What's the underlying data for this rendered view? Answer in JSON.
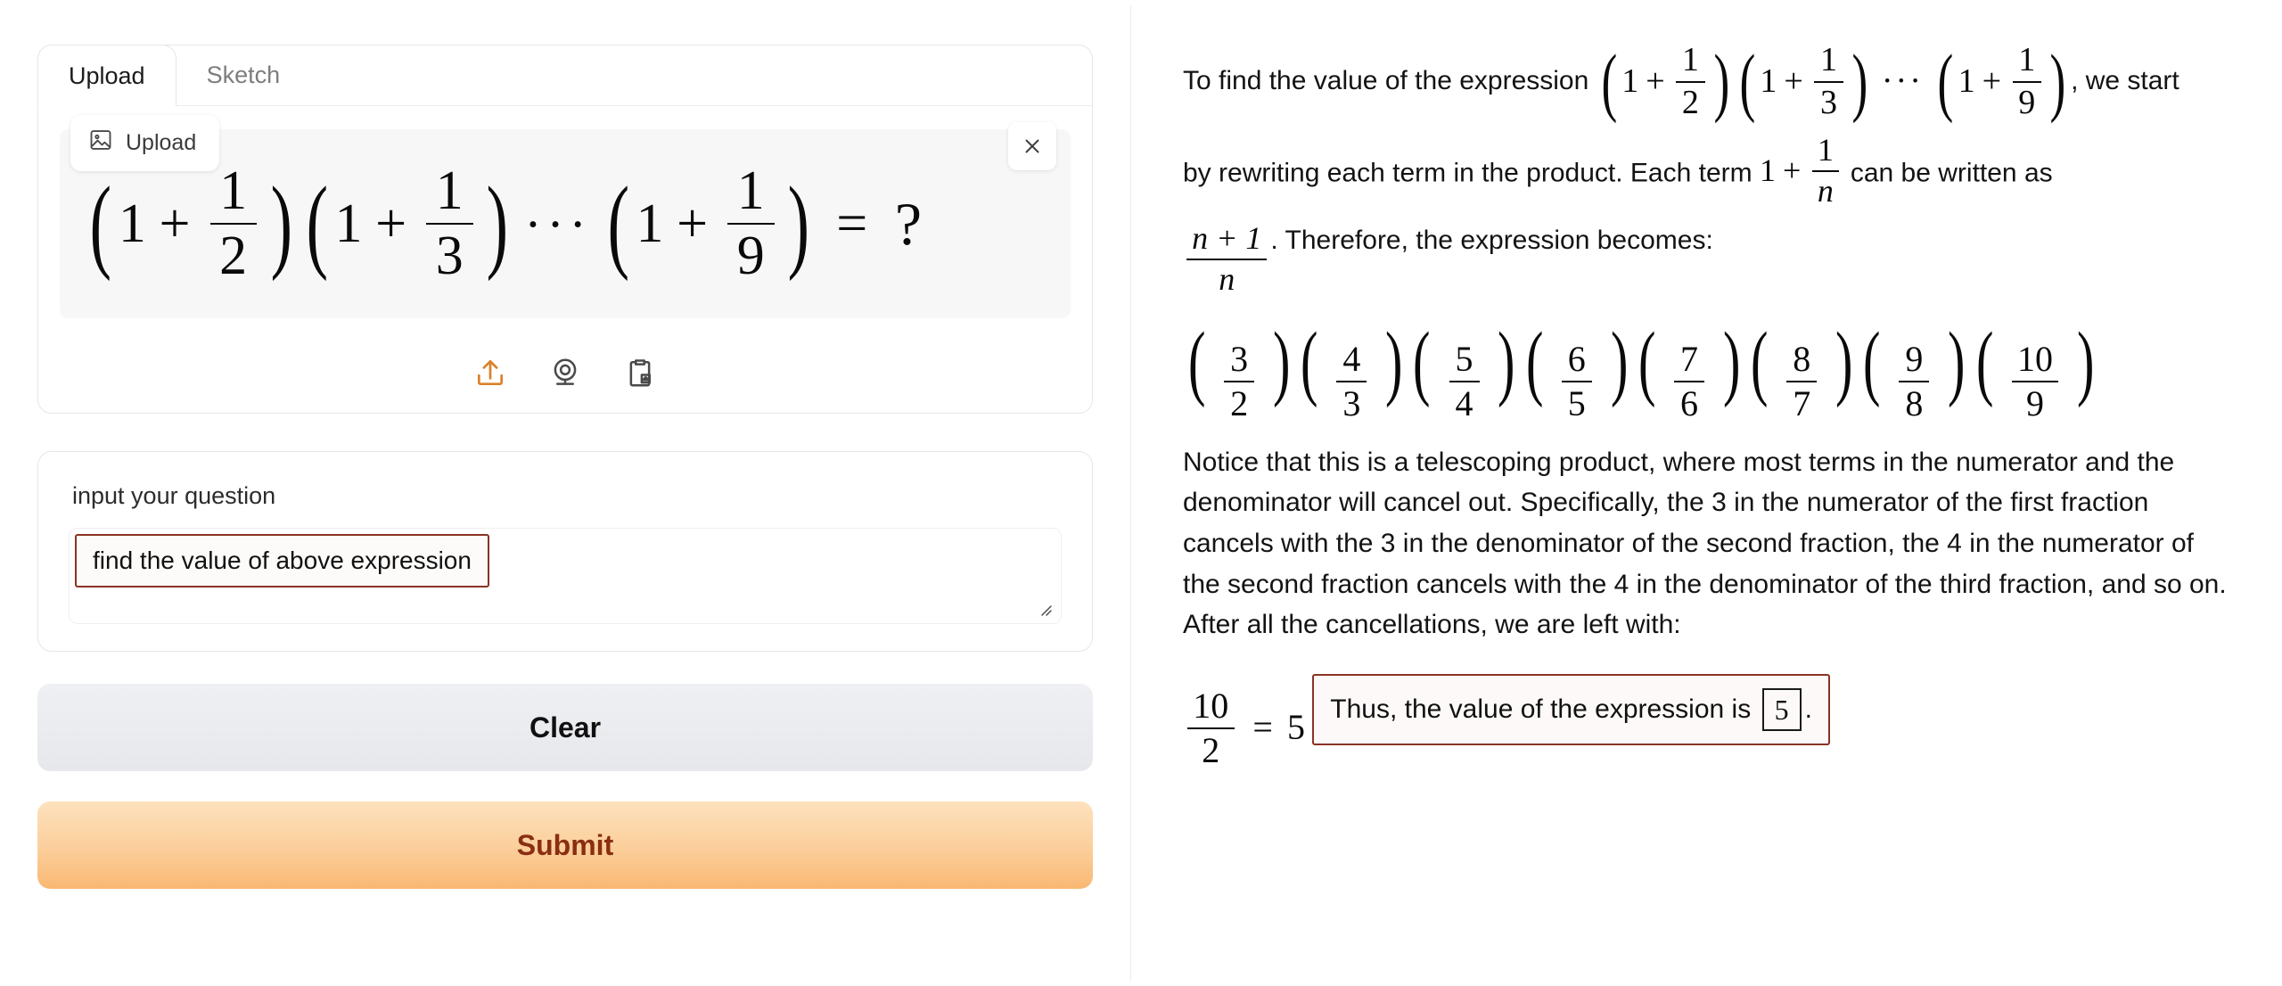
{
  "left": {
    "tabs": [
      {
        "label": "Upload",
        "active": true
      },
      {
        "label": "Sketch",
        "active": false
      }
    ],
    "upload_chip_label": "Upload",
    "close_label": "×",
    "preview_expression": {
      "terms": [
        {
          "one": "1",
          "plus": "+",
          "num": "1",
          "den": "2"
        },
        {
          "one": "1",
          "plus": "+",
          "num": "1",
          "den": "3"
        },
        {
          "one": "1",
          "plus": "+",
          "num": "1",
          "den": "9"
        }
      ],
      "ellipsis": "···",
      "equals": "=",
      "result": "?"
    },
    "toolbar_icons": [
      {
        "name": "upload-icon",
        "active": true
      },
      {
        "name": "webcam-icon",
        "active": false
      },
      {
        "name": "clipboard-paste-icon",
        "active": false
      }
    ],
    "question_label": "input your question",
    "question_value": "find the value of above expression",
    "clear_label": "Clear",
    "submit_label": "Submit",
    "accent_submit": "#f9b873",
    "accent_submit_text": "#8a2e12",
    "highlight_border": "#8a3324"
  },
  "right": {
    "para1_before": "To find the value of the expression",
    "para1_after": ", we start",
    "para2_before": "by rewriting each term in the product. Each term",
    "para2_term": {
      "one": "1",
      "plus": "+",
      "num": "1",
      "den": "n"
    },
    "para2_after": "can be written as",
    "para3_frac": {
      "num": "n + 1",
      "den": "n"
    },
    "para3_after": ". Therefore, the expression becomes:",
    "fraction_product": [
      {
        "num": "3",
        "den": "2"
      },
      {
        "num": "4",
        "den": "3"
      },
      {
        "num": "5",
        "den": "4"
      },
      {
        "num": "6",
        "den": "5"
      },
      {
        "num": "7",
        "den": "6"
      },
      {
        "num": "8",
        "den": "7"
      },
      {
        "num": "9",
        "den": "8"
      },
      {
        "num": "10",
        "den": "9"
      }
    ],
    "telescoping_paragraph": "Notice that this is a telescoping product, where most terms in the numerator and the denominator will cancel out. Specifically, the 3 in the numerator of the first fraction cancels with the 3 in the denominator of the second fraction, the 4 in the numerator of the second fraction cancels with the 4 in the denominator of the third fraction, and so on. After all the cancellations, we are left with:",
    "final_equation": {
      "num": "10",
      "den": "2",
      "equals": "=",
      "value": "5"
    },
    "conclusion_before": "Thus, the value of the expression is",
    "conclusion_value": "5",
    "conclusion_after": "."
  }
}
